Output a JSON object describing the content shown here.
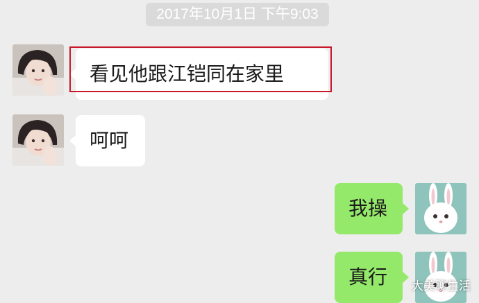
{
  "chat": {
    "timestamp": "2017年10月1日  下午9:03",
    "messages": [
      {
        "side": "left",
        "text": "看见他跟江铠同在家里"
      },
      {
        "side": "left",
        "text": "呵呵"
      },
      {
        "side": "right",
        "text": "我操"
      },
      {
        "side": "right",
        "text": "真行"
      }
    ]
  },
  "watermark": "大美聊生活",
  "colors": {
    "background": "#ededed",
    "incoming_bubble": "#ffffff",
    "outgoing_bubble": "#95e96a",
    "highlight": "#c8182a"
  }
}
